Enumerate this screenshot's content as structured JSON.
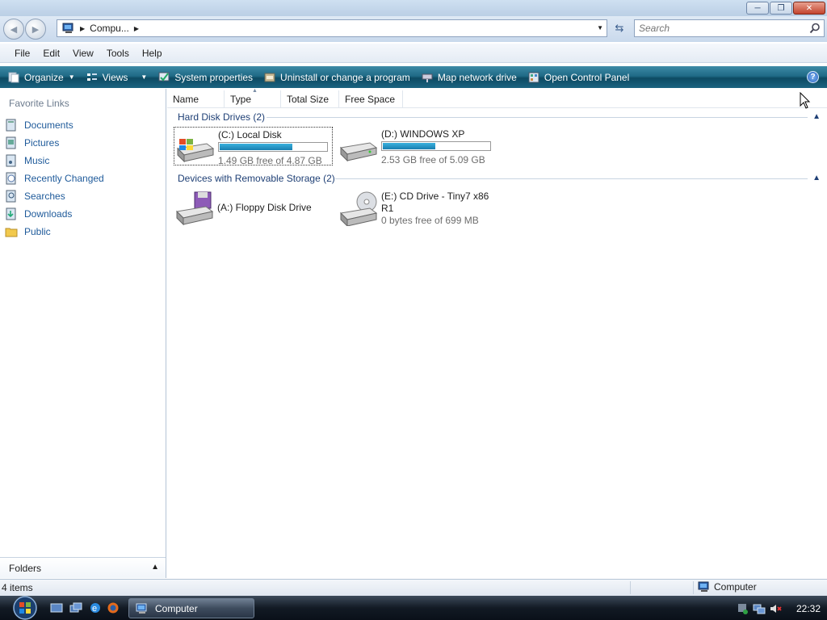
{
  "window": {
    "minimize_icon": "minimize-icon",
    "maximize_icon": "restore-icon",
    "close_icon": "close-icon"
  },
  "navbar": {
    "address_crumb": "Compu...",
    "search_placeholder": "Search"
  },
  "menu": [
    "File",
    "Edit",
    "View",
    "Tools",
    "Help"
  ],
  "commands": {
    "organize": "Organize",
    "views": "Views",
    "system_properties": "System properties",
    "uninstall": "Uninstall or change a program",
    "map_drive": "Map network drive",
    "control_panel": "Open Control Panel"
  },
  "sidebar": {
    "title": "Favorite Links",
    "items": [
      {
        "label": "Documents",
        "icon": "documents-icon"
      },
      {
        "label": "Pictures",
        "icon": "pictures-icon"
      },
      {
        "label": "Music",
        "icon": "music-icon"
      },
      {
        "label": "Recently Changed",
        "icon": "recent-icon"
      },
      {
        "label": "Searches",
        "icon": "searches-icon"
      },
      {
        "label": "Downloads",
        "icon": "downloads-icon"
      },
      {
        "label": "Public",
        "icon": "public-folder-icon"
      }
    ],
    "folders_label": "Folders"
  },
  "columns": [
    "Name",
    "Type",
    "Total Size",
    "Free Space"
  ],
  "groups": {
    "hard_disks": {
      "title": "Hard Disk Drives (2)",
      "drives": [
        {
          "name": "(C:) Local Disk",
          "free": "1.49 GB free of 4.87 GB",
          "used_fraction": 0.69
        },
        {
          "name": "(D:) WINDOWS XP",
          "free": "2.53 GB free of 5.09 GB",
          "used_fraction": 0.5
        }
      ]
    },
    "removable": {
      "title": "Devices with Removable Storage (2)",
      "drives": [
        {
          "name": "(A:) Floppy Disk Drive"
        },
        {
          "name_line1": "(E:) CD Drive - Tiny7 x86",
          "name_line2": "R1",
          "free": "0 bytes free of 699 MB"
        }
      ]
    }
  },
  "status": {
    "count": "4 items",
    "location": "Computer"
  },
  "taskbar": {
    "task_label": "Computer",
    "clock": "22:32"
  },
  "colors": {
    "accent": "#1f6a86",
    "link": "#1e5a9a",
    "group_header": "#1e3f75",
    "bar_fill": "#1a7fb0"
  }
}
